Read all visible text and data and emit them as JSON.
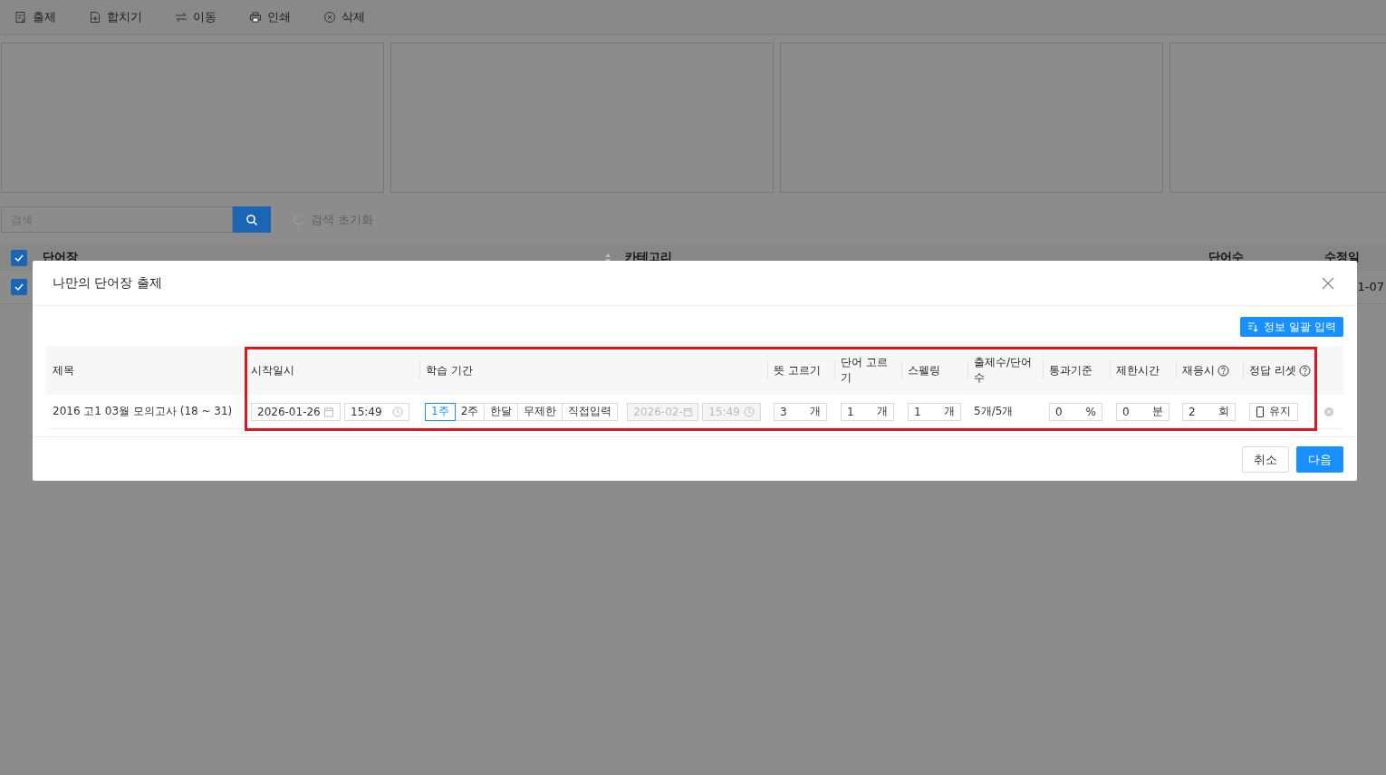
{
  "toolbar": [
    {
      "label": "출제"
    },
    {
      "label": "합치기"
    },
    {
      "label": "이동"
    },
    {
      "label": "인쇄"
    },
    {
      "label": "삭제"
    }
  ],
  "search": {
    "placeholder": "검색",
    "reset": "검색 초기화"
  },
  "table": {
    "select_all_checked": true,
    "columns": [
      "단어장",
      "카테고리",
      "단어수",
      "수정일"
    ],
    "rows": [
      {
        "checked": true,
        "date": "1-07"
      }
    ]
  },
  "dialog": {
    "title": "나만의 단어장 출제",
    "bulk_button": "정보 일괄 입력",
    "columns": [
      "제목",
      "시작일시",
      "학습 기간",
      "뜻 고르기",
      "단어 고르기",
      "스펠링",
      "출제수/단어수",
      "통과기준",
      "제한시간",
      "재응시",
      "정답 리셋"
    ],
    "row": {
      "title": "2016 고1 03월 모의고사 (18 ~ 31)",
      "start_date": "2026-01-26",
      "start_time": "15:49",
      "periods": [
        {
          "label": "1주",
          "selected": true
        },
        {
          "label": "2주",
          "selected": false
        },
        {
          "label": "한달",
          "selected": false
        },
        {
          "label": "무제한",
          "selected": false
        },
        {
          "label": "직접입력",
          "selected": false
        }
      ],
      "end_date": "2026-02-",
      "end_time": "15:49",
      "end_disabled": true,
      "meaning": {
        "value": "3",
        "unit": "개"
      },
      "word": {
        "value": "1",
        "unit": "개"
      },
      "spelling": {
        "value": "1",
        "unit": "개"
      },
      "count": "5개/5개",
      "pass": {
        "value": "0",
        "unit": "%"
      },
      "limit": {
        "value": "0",
        "unit": "분"
      },
      "retry": {
        "value": "2",
        "unit": "회"
      },
      "reset": {
        "label": "유지",
        "checked": false
      }
    },
    "buttons": {
      "cancel": "취소",
      "next": "다음"
    }
  }
}
